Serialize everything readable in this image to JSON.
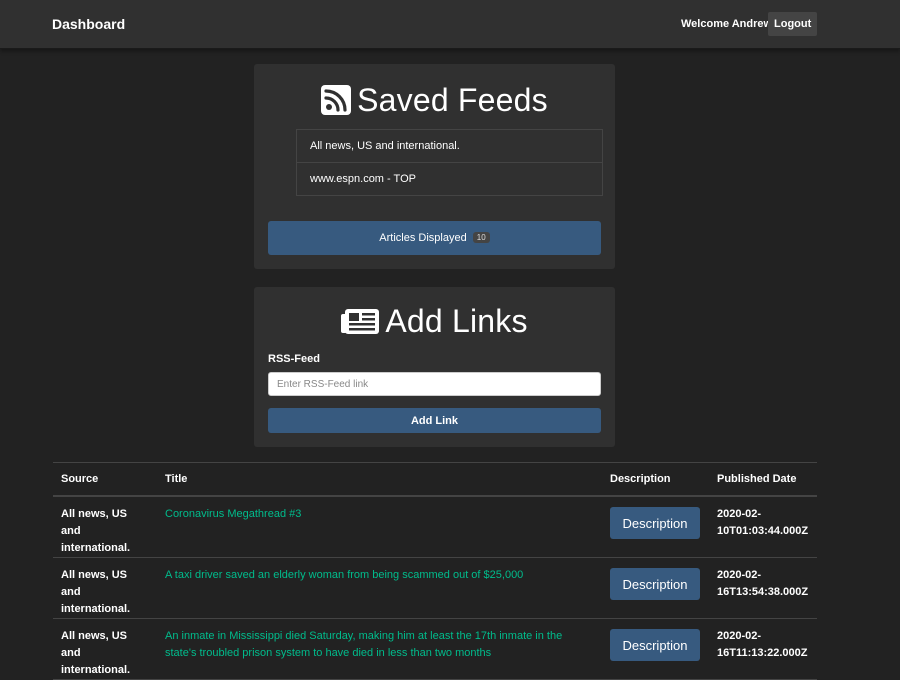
{
  "navbar": {
    "brand": "Dashboard",
    "welcome": "Welcome Andrew",
    "logout_label": "Logout"
  },
  "saved_feeds": {
    "title": "Saved Feeds",
    "icon": "rss-icon",
    "items": [
      {
        "label": "All news, US and international."
      },
      {
        "label": "www.espn.com - TOP"
      }
    ],
    "articles_button_label": "Articles Displayed",
    "articles_count": "10"
  },
  "add_links": {
    "title": "Add Links",
    "icon": "newspaper-icon",
    "field_label": "RSS-Feed",
    "input_placeholder": "Enter RSS-Feed link",
    "input_value": "",
    "button_label": "Add Link"
  },
  "table": {
    "headers": {
      "source": "Source",
      "title": "Title",
      "description": "Description",
      "published": "Published Date"
    },
    "rows": [
      {
        "source": "All news, US and international.",
        "title": "Coronavirus Megathread #3",
        "description_label": "Description",
        "published": "2020-02-10T01:03:44.000Z"
      },
      {
        "source": "All news, US and international.",
        "title": "A taxi driver saved an elderly woman from being scammed out of $25,000",
        "description_label": "Description",
        "published": "2020-02-16T13:54:38.000Z"
      },
      {
        "source": "All news, US and international.",
        "title": "An inmate in Mississippi died Saturday, making him at least the 17th inmate in the state's troubled prison system to have died in less than two months",
        "description_label": "Description",
        "published": "2020-02-16T11:13:22.000Z"
      }
    ]
  },
  "colors": {
    "background": "#222222",
    "card": "#303030",
    "primary": "#375a7f",
    "link": "#00bc8c"
  }
}
